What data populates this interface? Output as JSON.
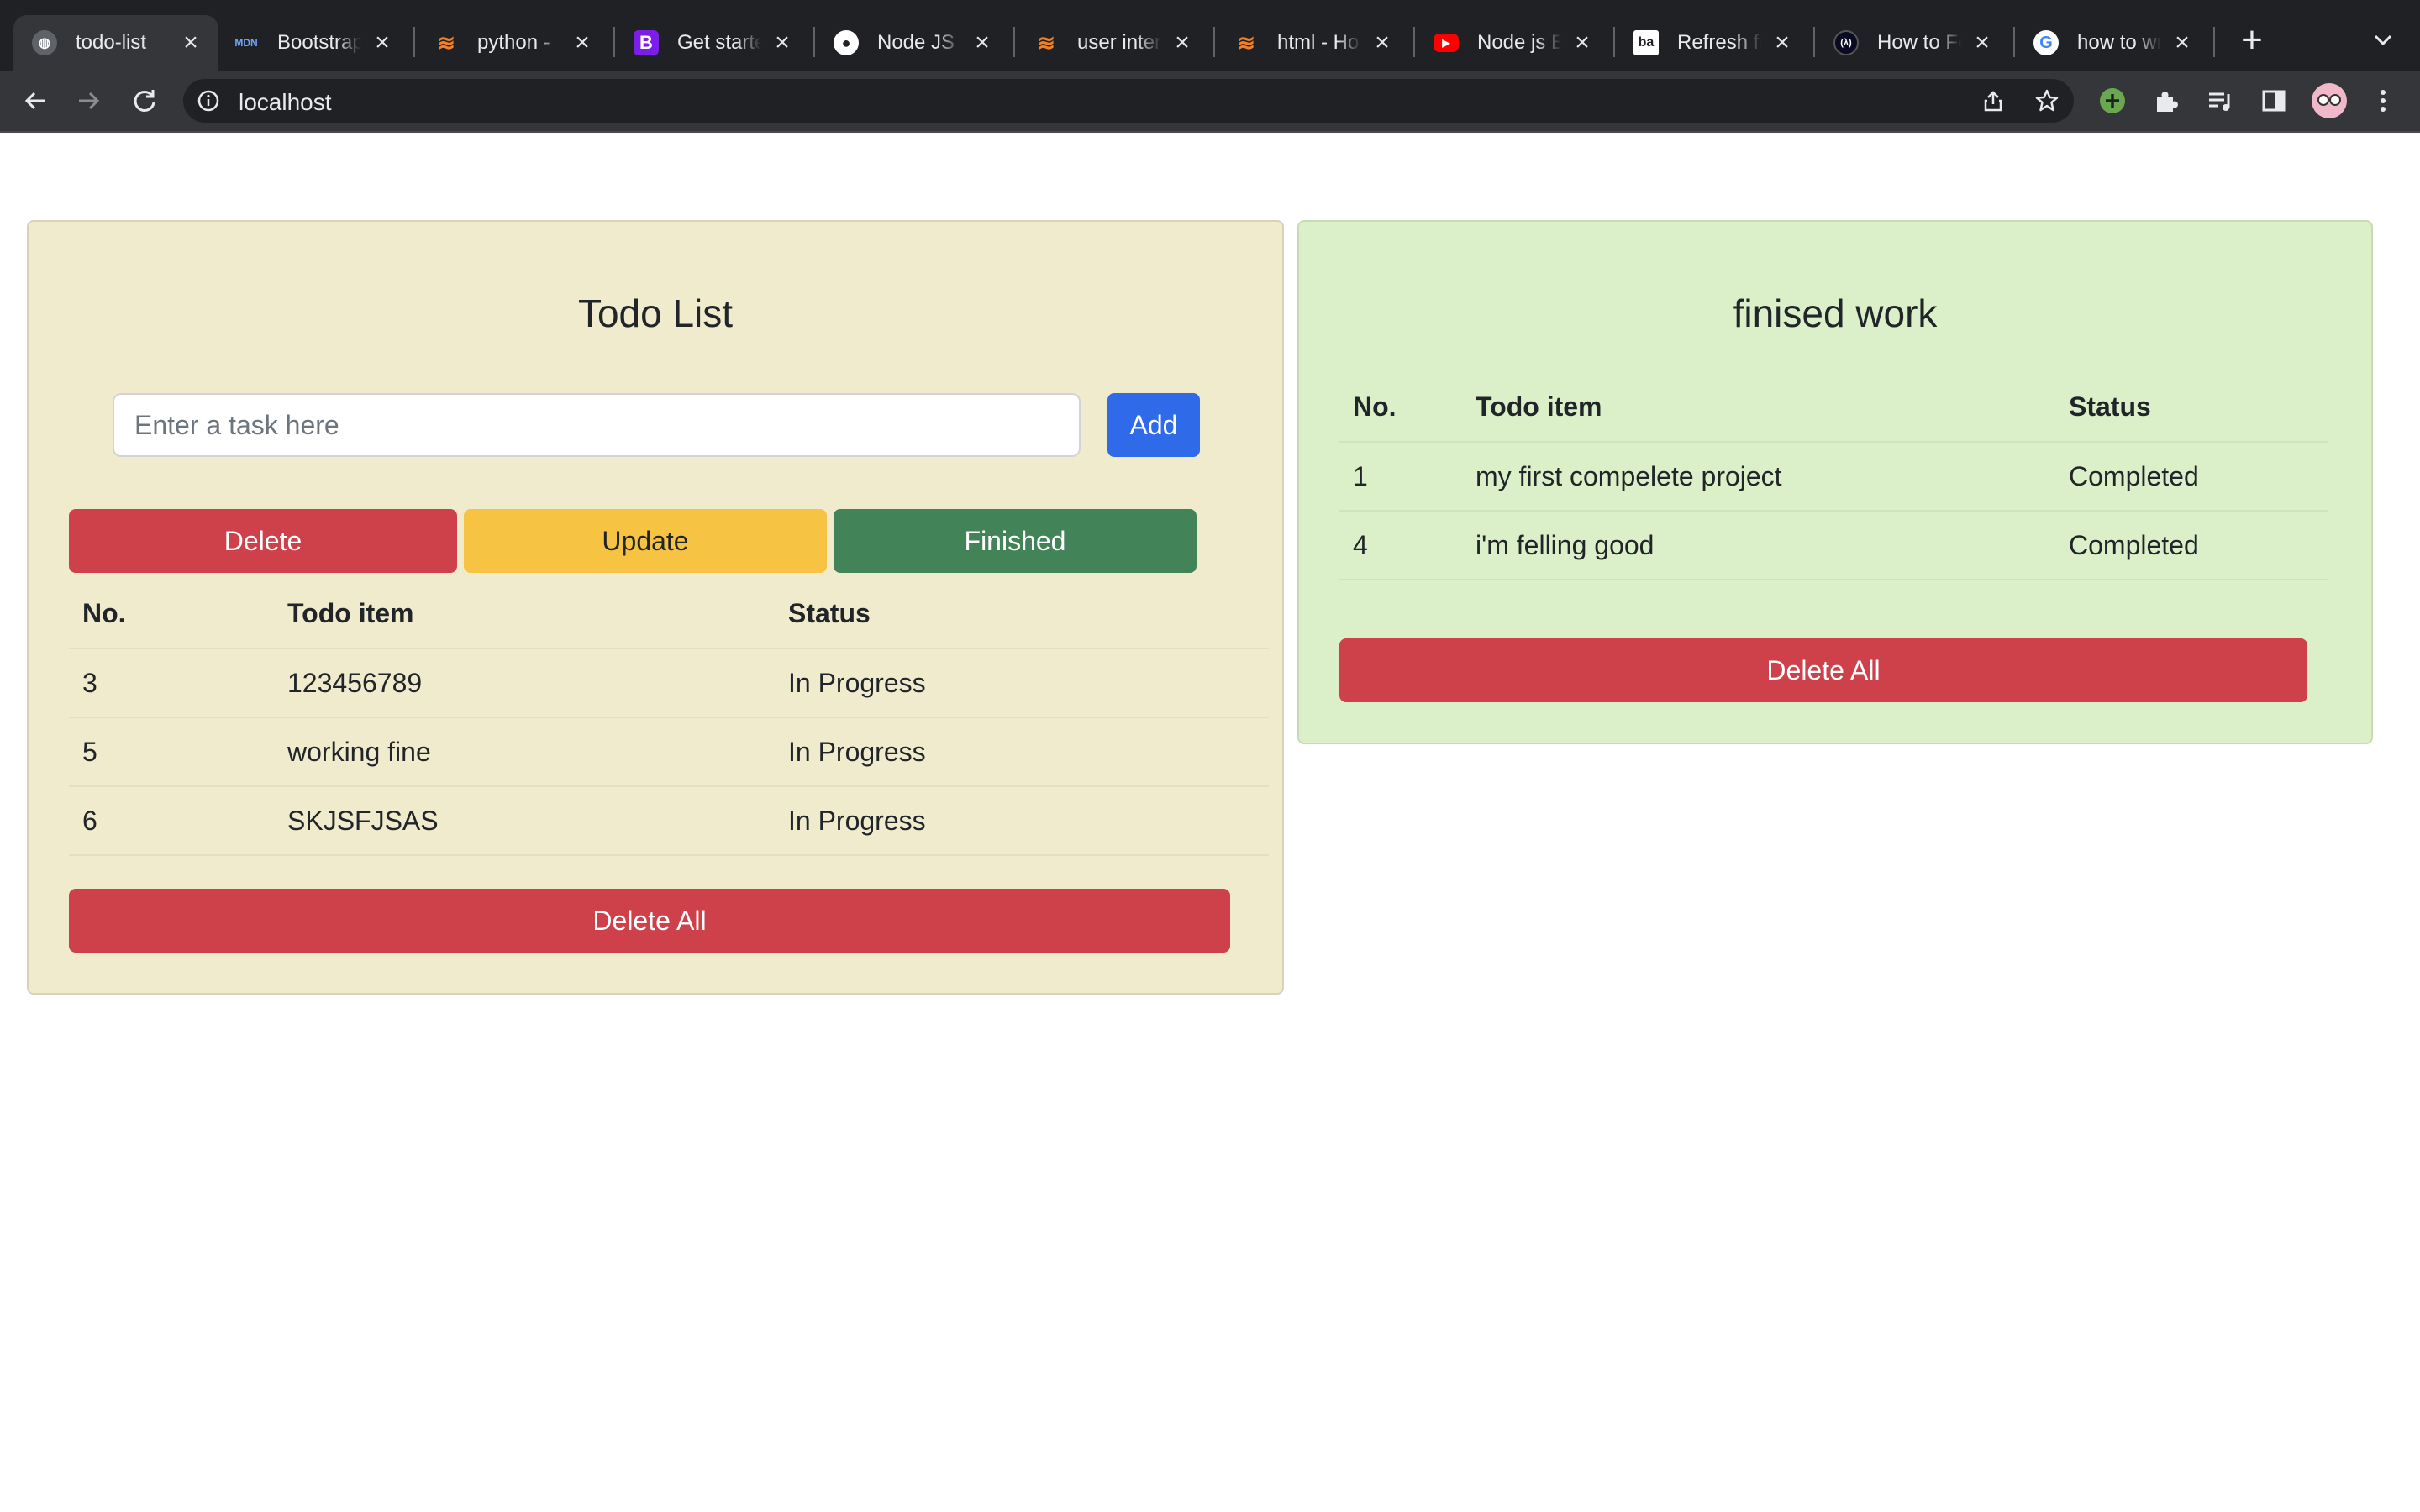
{
  "browser": {
    "tabs": [
      {
        "title": "todo-list",
        "icon": "globe-icon",
        "color": "#5f6368"
      },
      {
        "title": "Bootstrap",
        "icon": "mdn-icon",
        "color": "#2b6ccf"
      },
      {
        "title": "python - ",
        "icon": "stackoverflow-icon",
        "color": "#f48024"
      },
      {
        "title": "Get starte",
        "icon": "bootstrap-icon",
        "color": "#7b1ee8"
      },
      {
        "title": "Node JS a",
        "icon": "github-icon",
        "color": "#ffffff"
      },
      {
        "title": "user inter",
        "icon": "stackoverflow-icon",
        "color": "#f48024"
      },
      {
        "title": "html - Ho",
        "icon": "stackoverflow-icon",
        "color": "#f48024"
      },
      {
        "title": "Node js E",
        "icon": "youtube-icon",
        "color": "#ff0000"
      },
      {
        "title": "Refresh fr",
        "icon": "baeldung-icon",
        "color": "#ffffff"
      },
      {
        "title": "How to Fo",
        "icon": "freecodecamp-icon",
        "color": "#0a0a23"
      },
      {
        "title": "how to wr",
        "icon": "google-icon",
        "color": "#ffffff"
      }
    ],
    "tab_glyphs": [
      "◍",
      "MDN",
      "≋",
      "B",
      "●",
      "≋",
      "≋",
      "▶",
      "ba",
      "(λ)",
      "G"
    ],
    "close_glyph": "×",
    "new_tab_glyph": "+",
    "address": "localhost"
  },
  "todo": {
    "title": "Todo List",
    "input_placeholder": "Enter a task here",
    "add_label": "Add",
    "delete_label": "Delete",
    "update_label": "Update",
    "finished_label": "Finished",
    "columns": [
      "No.",
      "Todo item",
      "Status"
    ],
    "rows": [
      [
        "3",
        "123456789",
        "In Progress"
      ],
      [
        "5",
        "working fine",
        "In Progress"
      ],
      [
        "6",
        "SKJSFJSAS",
        "In Progress"
      ]
    ],
    "delete_all_label": "Delete All"
  },
  "finished": {
    "title": "finised work",
    "columns": [
      "No.",
      "Todo item",
      "Status"
    ],
    "rows": [
      [
        "1",
        "my first compelete project",
        "Completed"
      ],
      [
        "4",
        "i'm felling good",
        "Completed"
      ]
    ],
    "delete_all_label": "Delete All"
  },
  "colors": {
    "todo_card_bg": "#f0ebcd",
    "finished_card_bg": "#dbf0c8",
    "danger": "#cf414a",
    "warning": "#f6c342",
    "success": "#428457",
    "primary": "#2f6be8"
  }
}
